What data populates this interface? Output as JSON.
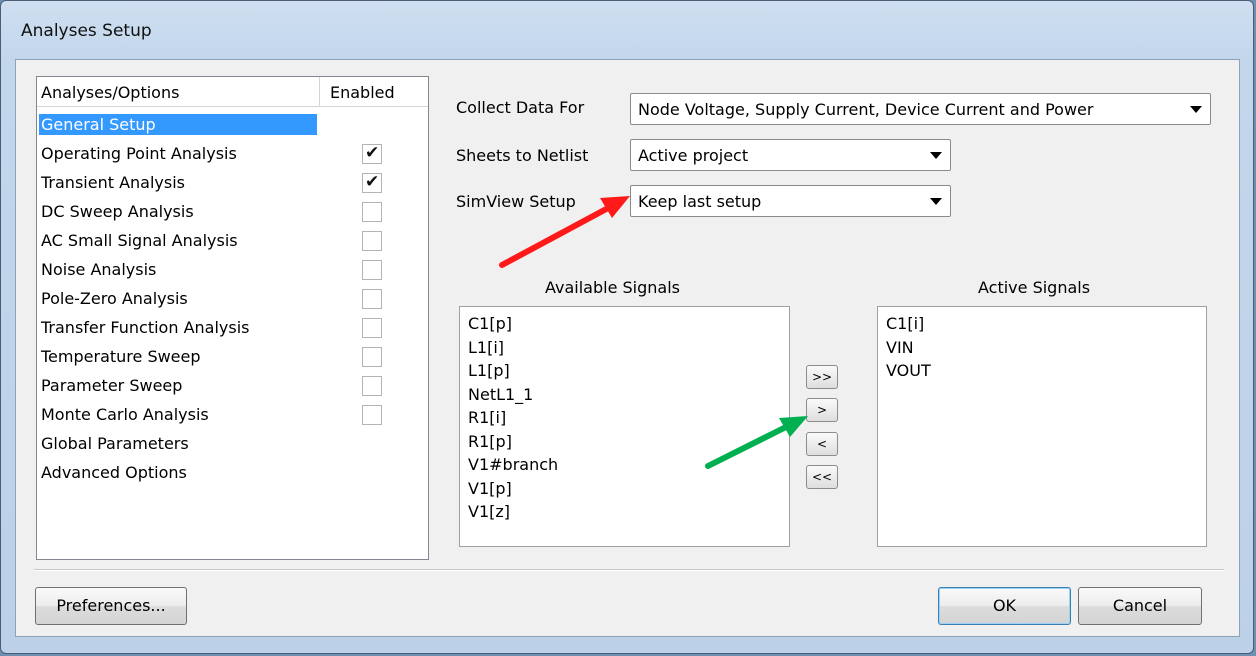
{
  "window": {
    "title": "Analyses Setup"
  },
  "list": {
    "header_col1": "Analyses/Options",
    "header_col2": "Enabled",
    "items": [
      {
        "label": "General Setup",
        "selected": true,
        "has_checkbox": false,
        "checked": false
      },
      {
        "label": "Operating Point Analysis",
        "selected": false,
        "has_checkbox": true,
        "checked": true
      },
      {
        "label": "Transient Analysis",
        "selected": false,
        "has_checkbox": true,
        "checked": true
      },
      {
        "label": "DC Sweep Analysis",
        "selected": false,
        "has_checkbox": true,
        "checked": false
      },
      {
        "label": "AC Small Signal Analysis",
        "selected": false,
        "has_checkbox": true,
        "checked": false
      },
      {
        "label": "Noise Analysis",
        "selected": false,
        "has_checkbox": true,
        "checked": false
      },
      {
        "label": "Pole-Zero Analysis",
        "selected": false,
        "has_checkbox": true,
        "checked": false
      },
      {
        "label": "Transfer Function Analysis",
        "selected": false,
        "has_checkbox": true,
        "checked": false
      },
      {
        "label": "Temperature Sweep",
        "selected": false,
        "has_checkbox": true,
        "checked": false
      },
      {
        "label": "Parameter Sweep",
        "selected": false,
        "has_checkbox": true,
        "checked": false
      },
      {
        "label": "Monte Carlo Analysis",
        "selected": false,
        "has_checkbox": true,
        "checked": false
      },
      {
        "label": "Global Parameters",
        "selected": false,
        "has_checkbox": false,
        "checked": false
      },
      {
        "label": "Advanced Options",
        "selected": false,
        "has_checkbox": false,
        "checked": false
      }
    ]
  },
  "form": {
    "collect_label": "Collect Data For",
    "collect_value": "Node Voltage, Supply Current, Device Current and Power",
    "sheets_label": "Sheets to Netlist",
    "sheets_value": "Active project",
    "simview_label": "SimView Setup",
    "simview_value": "Keep last setup"
  },
  "signals": {
    "available_label": "Available Signals",
    "available": [
      "C1[p]",
      "L1[i]",
      "L1[p]",
      "NetL1_1",
      "R1[i]",
      "R1[p]",
      "V1#branch",
      "V1[p]",
      "V1[z]"
    ],
    "active_label": "Active Signals",
    "active": [
      "C1[i]",
      "VIN",
      "VOUT"
    ],
    "add_all_label": ">>",
    "add_label": ">",
    "remove_label": "<",
    "remove_all_label": "<<"
  },
  "buttons": {
    "preferences_label": "Preferences...",
    "ok_label": "OK",
    "cancel_label": "Cancel"
  },
  "annotations": {
    "red_arrow_color": "#ff1a1a",
    "green_arrow_color": "#00b050"
  }
}
